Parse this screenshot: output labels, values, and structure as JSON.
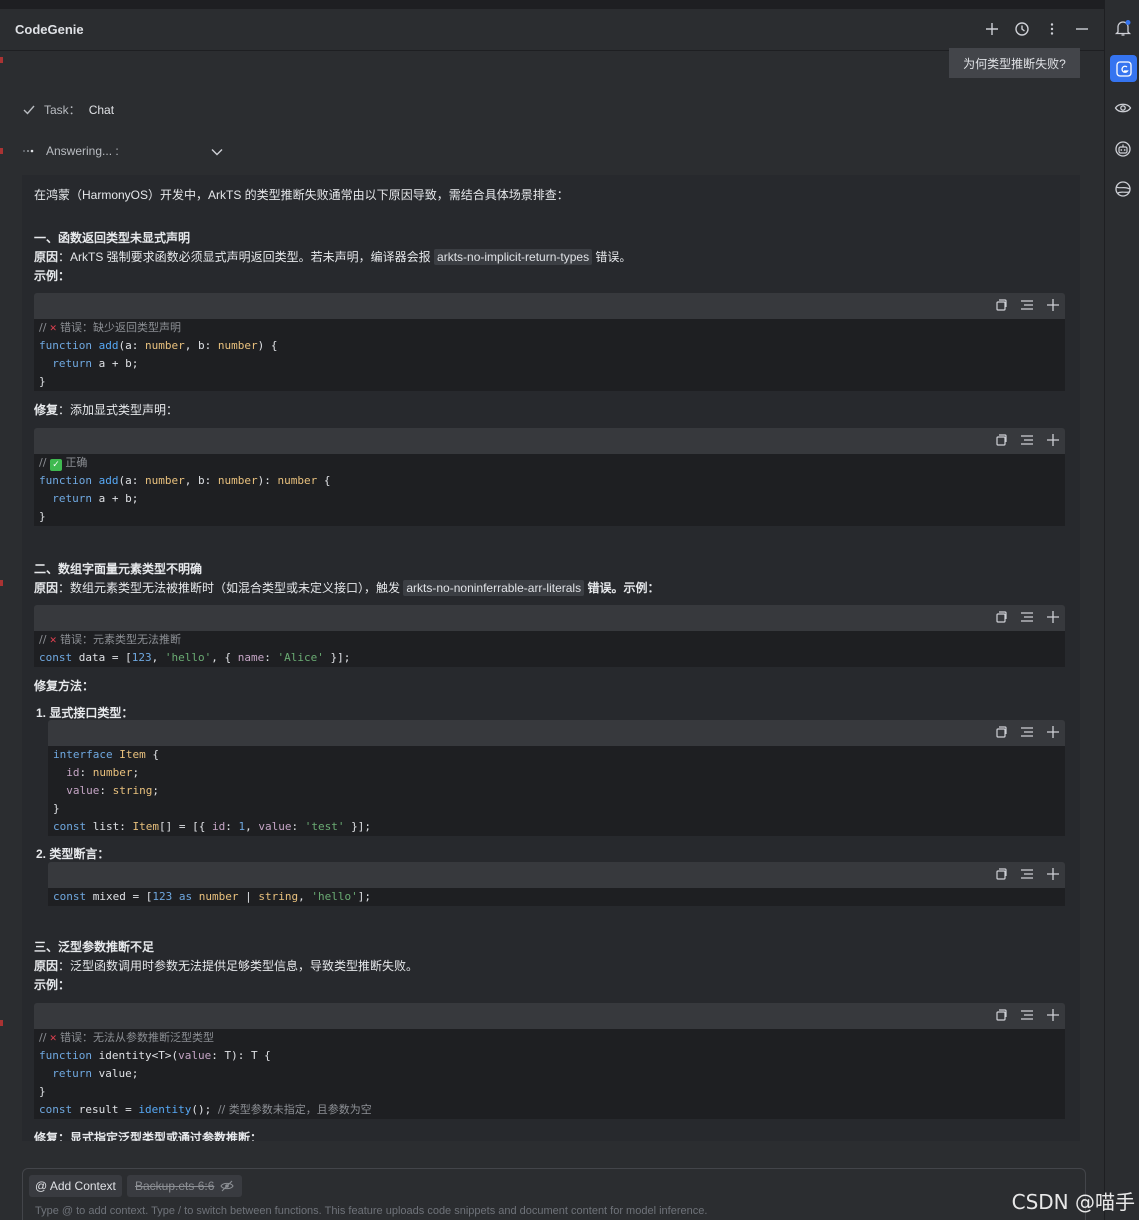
{
  "app": {
    "title": "CodeGenie"
  },
  "header": {
    "icons": [
      "plus-icon",
      "history-icon",
      "more-icon",
      "minimize-icon"
    ]
  },
  "user_message": "为何类型推断失败?",
  "task": {
    "label": "Task：",
    "value": "Chat"
  },
  "status": {
    "label": "Answering... :"
  },
  "answer": {
    "intro": "在鸿蒙（HarmonyOS）开发中，ArkTS 的类型推断失败通常由以下原因导致，需结合具体场景排查：",
    "s1_title": "一、函数返回类型未显式声明",
    "s1_reason_key": "原因",
    "s1_reason_a": "：ArkTS 强制要求函数必须显式声明返回类型。若未声明，编译器会报",
    "s1_reason_chip": "arkts-no-implicit-return-types",
    "s1_reason_b": "错误。",
    "s1_example": "示例",
    "s1_example_colon": "：",
    "s1_fix_key": "修复",
    "s1_fix_text": "：添加显式类型声明：",
    "s2_title": "二、数组字面量元素类型不明确",
    "s2_reason_key": "原因",
    "s2_reason_a": "：数组元素类型无法被推断时（如混合类型或未定义接口），触发",
    "s2_reason_chip": "arkts-no-noninferrable-arr-literals",
    "s2_reason_b": "错误。示例：",
    "s2_fix_title": "修复方法",
    "s2_fix_colon": "：",
    "s2_item1": "1. 显式接口类型",
    "s2_item1_colon": "：",
    "s2_item2": "2. 类型断言",
    "s2_item2_colon": "：",
    "s3_title": "三、泛型参数推断不足",
    "s3_reason_key": "原因",
    "s3_reason_text": "：泛型函数调用时参数无法提供足够类型信息，导致类型推断失败。",
    "s3_example": "示例",
    "s3_example_colon": "：",
    "s3_fix_key": "修复",
    "s3_fix_text": "：显式指定泛型类型或通过参数推断："
  },
  "code": {
    "c1_comment": " 错误：缺少返回类型声明",
    "c2_comment": " 正确",
    "c3_comment": " 错误：元素类型无法推断",
    "c6_comment": " 错误：无法从参数推断泛型类型",
    "c6_tail_comment": "// 类型参数未指定，且参数为空"
  },
  "input": {
    "add_context": "@ Add Context",
    "file_chip": "Backup.ets 6:6",
    "placeholder": "Type @ to add context. Type / to switch between functions. This feature uploads code snippets and document content for model inference."
  },
  "watermark": "CSDN @喵手"
}
